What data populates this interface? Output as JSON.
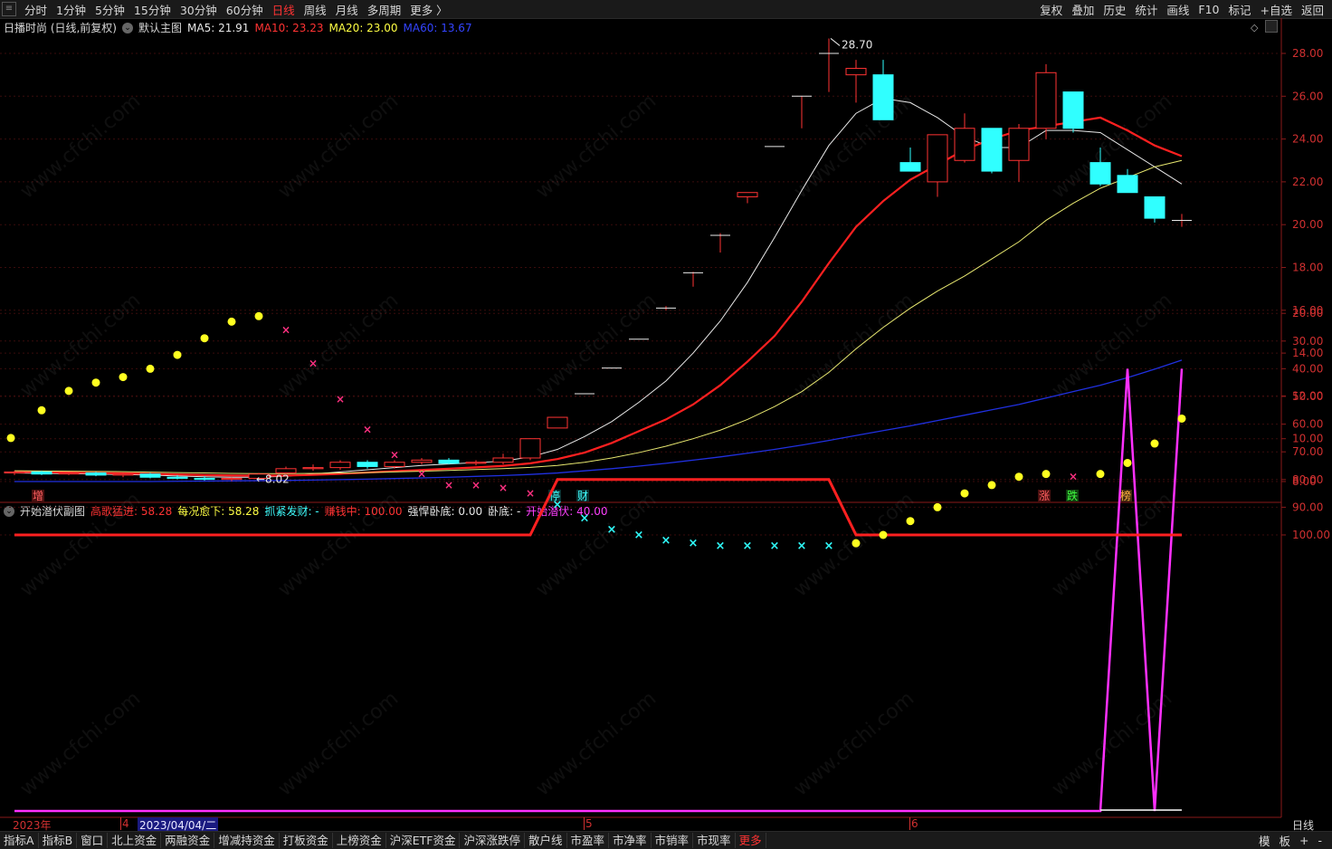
{
  "topbar": {
    "periods": [
      {
        "label": "分时",
        "active": false
      },
      {
        "label": "1分钟",
        "active": false
      },
      {
        "label": "5分钟",
        "active": false
      },
      {
        "label": "15分钟",
        "active": false
      },
      {
        "label": "30分钟",
        "active": false
      },
      {
        "label": "60分钟",
        "active": false
      },
      {
        "label": "日线",
        "active": true
      },
      {
        "label": "周线",
        "active": false
      },
      {
        "label": "月线",
        "active": false
      },
      {
        "label": "多周期",
        "active": false
      },
      {
        "label": "更多 〉",
        "active": false
      }
    ],
    "tools": [
      "复权",
      "叠加",
      "历史",
      "统计",
      "画线",
      "F10",
      "标记",
      "+自选",
      "返回"
    ]
  },
  "main_chart": {
    "stock_title": "日播时尚 (日线,前复权)",
    "template": "默认主图",
    "ma": [
      {
        "label": "MA5: 21.91",
        "color": "#e8e8e8"
      },
      {
        "label": "MA10: 23.23",
        "color": "#ff3333"
      },
      {
        "label": "MA20: 23.00",
        "color": "#ffff44"
      },
      {
        "label": "MA60: 13.67",
        "color": "#3344ff"
      }
    ],
    "price_ticks": [
      "28.00",
      "26.00",
      "24.00",
      "22.00",
      "20.00",
      "18.00",
      "16.00",
      "14.00",
      "12.00",
      "10.00",
      "8.00"
    ],
    "high_label": "28.70",
    "low_label": "8.02",
    "event_tags": [
      {
        "text": "增",
        "color": "#ff6060",
        "bg": "#4a1010"
      },
      {
        "text": "停",
        "color": "#40ffff",
        "bg": "#0a3030"
      },
      {
        "text": "财",
        "color": "#40ffff",
        "bg": "#0a3030"
      },
      {
        "text": "涨",
        "color": "#ff6060",
        "bg": "#4a1010"
      },
      {
        "text": "跌",
        "color": "#40ff40",
        "bg": "#104010"
      },
      {
        "text": "榜",
        "color": "#ffb040",
        "bg": "#402a10"
      }
    ]
  },
  "sub_chart": {
    "title": "开始潜伏副图",
    "indicators": [
      {
        "label": "高歌猛进: 58.28",
        "color": "#ff3333"
      },
      {
        "label": "每况愈下: 58.28",
        "color": "#ffff44"
      },
      {
        "label": "抓紧发财: -",
        "color": "#40ffff"
      },
      {
        "label": "赚钱中: 100.00",
        "color": "#ff3333"
      },
      {
        "label": "强悍卧底: 0.00",
        "color": "#e8e8e8"
      },
      {
        "label": "卧底: -",
        "color": "#e8e8e8"
      },
      {
        "label": "开始潜伏: 40.00",
        "color": "#ff40ff"
      }
    ],
    "ticks": [
      "100.00",
      "90.00",
      "80.00",
      "70.00",
      "60.00",
      "50.00",
      "40.00",
      "30.00",
      "20.00"
    ]
  },
  "date_axis": {
    "year": "2023年",
    "month4": "4",
    "cursor_date": "2023/04/04/二",
    "month5": "5",
    "month6": "6",
    "period": "日线"
  },
  "bottombar": {
    "tabs": [
      "指标A",
      "指标B",
      "窗口",
      "北上资金",
      "两融资金",
      "增减持资金",
      "打板资金",
      "上榜资金",
      "沪深ETF资金",
      "沪深涨跌停",
      "散户线",
      "市盈率",
      "市净率",
      "市销率",
      "市现率",
      "更多"
    ],
    "right": [
      "模",
      "板",
      "+",
      "-"
    ]
  },
  "watermark": "www.cfchi.com",
  "chart_data": {
    "type": "candlestick",
    "candles": [
      [
        8.4,
        8.5,
        8.3,
        8.45
      ],
      [
        8.45,
        8.5,
        8.3,
        8.35
      ],
      [
        8.35,
        8.45,
        8.3,
        8.4
      ],
      [
        8.4,
        8.45,
        8.25,
        8.3
      ],
      [
        8.3,
        8.4,
        8.2,
        8.35
      ],
      [
        8.35,
        8.4,
        8.15,
        8.2
      ],
      [
        8.2,
        8.3,
        8.1,
        8.15
      ],
      [
        8.15,
        8.25,
        8.05,
        8.1
      ],
      [
        8.1,
        8.2,
        8.02,
        8.15
      ],
      [
        8.15,
        8.4,
        8.1,
        8.35
      ],
      [
        8.4,
        8.7,
        8.35,
        8.6
      ],
      [
        8.6,
        8.8,
        8.5,
        8.65
      ],
      [
        8.65,
        9.0,
        8.55,
        8.9
      ],
      [
        8.9,
        9.0,
        8.6,
        8.7
      ],
      [
        8.7,
        9.0,
        8.6,
        8.9
      ],
      [
        8.9,
        9.1,
        8.8,
        9.0
      ],
      [
        9.0,
        9.1,
        8.8,
        8.85
      ],
      [
        8.85,
        9.0,
        8.75,
        8.9
      ],
      [
        8.9,
        9.3,
        8.8,
        9.1
      ],
      [
        9.1,
        10.0,
        9.0,
        10.0
      ],
      [
        10.5,
        11.0,
        10.5,
        11.0
      ],
      [
        12.1,
        12.1,
        12.1,
        12.1
      ],
      [
        13.3,
        13.3,
        13.3,
        13.3
      ],
      [
        14.65,
        14.65,
        14.65,
        14.65
      ],
      [
        16.1,
        16.2,
        16.0,
        16.1
      ],
      [
        17.75,
        17.8,
        17.1,
        17.75
      ],
      [
        19.5,
        19.6,
        18.7,
        19.5
      ],
      [
        21.3,
        21.5,
        21.0,
        21.5
      ],
      [
        23.65,
        23.65,
        23.65,
        23.65
      ],
      [
        26.0,
        26.0,
        24.5,
        26.0
      ],
      [
        28.0,
        28.7,
        26.2,
        28.0
      ],
      [
        27.0,
        27.7,
        25.7,
        27.3
      ],
      [
        27.0,
        27.7,
        24.9,
        24.9
      ],
      [
        22.9,
        23.6,
        22.8,
        22.5
      ],
      [
        22.0,
        24.2,
        21.3,
        24.2
      ],
      [
        23.0,
        25.2,
        22.9,
        24.5
      ],
      [
        24.5,
        24.5,
        22.4,
        22.5
      ],
      [
        23.0,
        24.7,
        22.0,
        24.5
      ],
      [
        24.5,
        27.5,
        24.0,
        27.1
      ],
      [
        26.2,
        26.2,
        24.3,
        24.5
      ],
      [
        22.9,
        23.6,
        21.8,
        21.9
      ],
      [
        22.3,
        22.6,
        21.6,
        21.5
      ],
      [
        21.3,
        21.3,
        20.1,
        20.3
      ],
      [
        20.2,
        20.5,
        19.9,
        20.2
      ]
    ],
    "ma_lines": {
      "MA5": [
        8.4,
        8.38,
        8.37,
        8.35,
        8.33,
        8.3,
        8.26,
        8.22,
        8.2,
        8.2,
        8.25,
        8.35,
        8.45,
        8.55,
        8.65,
        8.75,
        8.82,
        8.88,
        8.95,
        9.15,
        9.5,
        10.1,
        10.8,
        11.7,
        12.7,
        14.0,
        15.5,
        17.3,
        19.4,
        21.6,
        23.7,
        25.2,
        25.9,
        25.7,
        25.0,
        24.1,
        23.6,
        23.6,
        24.4,
        24.4,
        24.3,
        23.5,
        22.7,
        21.9
      ],
      "MA10": [
        8.45,
        8.44,
        8.42,
        8.4,
        8.38,
        8.36,
        8.33,
        8.3,
        8.28,
        8.27,
        8.28,
        8.31,
        8.36,
        8.42,
        8.48,
        8.54,
        8.6,
        8.66,
        8.73,
        8.85,
        9.05,
        9.35,
        9.8,
        10.35,
        10.9,
        11.6,
        12.5,
        13.6,
        14.8,
        16.4,
        18.2,
        19.9,
        21.1,
        22.1,
        22.8,
        23.5,
        24.0,
        24.4,
        24.6,
        24.8,
        25.0,
        24.4,
        23.7,
        23.2
      ],
      "MA20": [
        8.5,
        8.49,
        8.48,
        8.47,
        8.46,
        8.44,
        8.42,
        8.4,
        8.38,
        8.37,
        8.37,
        8.38,
        8.4,
        8.42,
        8.45,
        8.48,
        8.52,
        8.56,
        8.6,
        8.66,
        8.75,
        8.9,
        9.1,
        9.35,
        9.65,
        10.0,
        10.4,
        10.9,
        11.5,
        12.2,
        13.1,
        14.2,
        15.2,
        16.1,
        16.9,
        17.6,
        18.4,
        19.2,
        20.2,
        21.0,
        21.7,
        22.2,
        22.7,
        23.0
      ],
      "MA60": [
        8.0,
        8.0,
        8.0,
        8.0,
        8.0,
        8.0,
        8.01,
        8.02,
        8.03,
        8.04,
        8.05,
        8.07,
        8.09,
        8.11,
        8.14,
        8.17,
        8.2,
        8.24,
        8.28,
        8.33,
        8.4,
        8.5,
        8.6,
        8.72,
        8.85,
        9.0,
        9.15,
        9.32,
        9.5,
        9.7,
        9.92,
        10.15,
        10.38,
        10.6,
        10.85,
        11.1,
        11.35,
        11.6,
        11.9,
        12.2,
        12.5,
        12.85,
        13.25,
        13.67
      ]
    },
    "sub_series": {
      "step_line": [
        100,
        100,
        100,
        100,
        100,
        100,
        100,
        100,
        100,
        100,
        100,
        100,
        100,
        100,
        100,
        100,
        100,
        100,
        100,
        100,
        80,
        80,
        80,
        80,
        80,
        80,
        80,
        80,
        80,
        80,
        80,
        100,
        100,
        100,
        100,
        100,
        100,
        100,
        100,
        100,
        100,
        100,
        100,
        100
      ],
      "dots": [
        65,
        55,
        48,
        45,
        43,
        40,
        35,
        29,
        23,
        21,
        26,
        38,
        51,
        62,
        71,
        78,
        82,
        82,
        83,
        85,
        89,
        94,
        98,
        100,
        102,
        103,
        104,
        104,
        104,
        104,
        104,
        103,
        100,
        95,
        90,
        85,
        82,
        79,
        78,
        79,
        78,
        74,
        67,
        58
      ],
      "dot_types": [
        "y",
        "y",
        "y",
        "y",
        "y",
        "y",
        "y",
        "y",
        "y",
        "y",
        "m",
        "m",
        "m",
        "m",
        "m",
        "m",
        "m",
        "m",
        "m",
        "m",
        "c",
        "c",
        "c",
        "c",
        "c",
        "c",
        "c",
        "c",
        "c",
        "c",
        "c",
        "y",
        "y",
        "y",
        "y",
        "y",
        "y",
        "y",
        "y",
        "m",
        "y",
        "y",
        "y",
        "y"
      ],
      "latent": [
        0,
        0,
        0,
        0,
        0,
        0,
        0,
        0,
        0,
        0,
        0,
        0,
        0,
        0,
        0,
        0,
        0,
        0,
        0,
        0,
        0,
        0,
        0,
        0,
        0,
        0,
        0,
        0,
        0,
        0,
        0,
        0,
        0,
        0,
        0,
        0,
        0,
        0,
        0,
        0,
        0,
        40,
        0,
        40
      ]
    }
  }
}
